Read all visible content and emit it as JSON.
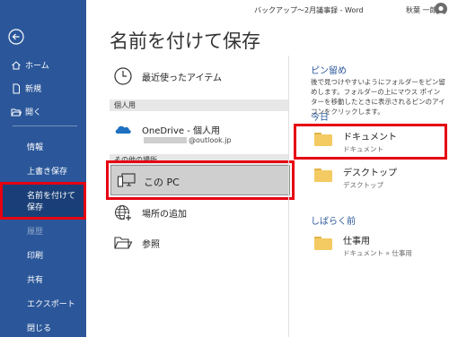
{
  "window": {
    "doc_title": "バックアップ～2月議事録  -  Word",
    "user_name": "秋葉 一郎"
  },
  "sidebar": {
    "home": "ホーム",
    "new": "新規",
    "open": "開く",
    "info": "情報",
    "save": "上書き保存",
    "save_as": "名前を付けて保存",
    "history": "履歴",
    "print": "印刷",
    "share": "共有",
    "export": "エクスポート",
    "close": "閉じる"
  },
  "page_title": "名前を付けて保存",
  "locations": {
    "recent": "最近使ったアイテム",
    "personal_header": "個人用",
    "onedrive_name": "OneDrive - 個人用",
    "onedrive_email": "@outlook.jp",
    "other_header": "その他の場所",
    "this_pc": "この PC",
    "add_place": "場所の追加",
    "browse": "参照"
  },
  "right": {
    "pinned_header": "ピン留め",
    "pinned_desc": "後で見つけやすいようにフォルダーをピン留めします。フォルダーの上にマウス ポインターを移動したときに表示されるピンのアイコンをクリックします。",
    "today_header": "今日",
    "earlier_header": "しばらく前",
    "today_folders": [
      {
        "name": "ドキュメント",
        "path": "ドキュメント"
      },
      {
        "name": "デスクトップ",
        "path": "デスクトップ"
      }
    ],
    "earlier_folders": [
      {
        "name": "仕事用",
        "path": "ドキュメント » 仕事用"
      }
    ]
  },
  "colors": {
    "sidebar": "#2b579a",
    "highlight": "#e60012",
    "accent_text": "#2b579a",
    "folder": "#f3cb62"
  }
}
